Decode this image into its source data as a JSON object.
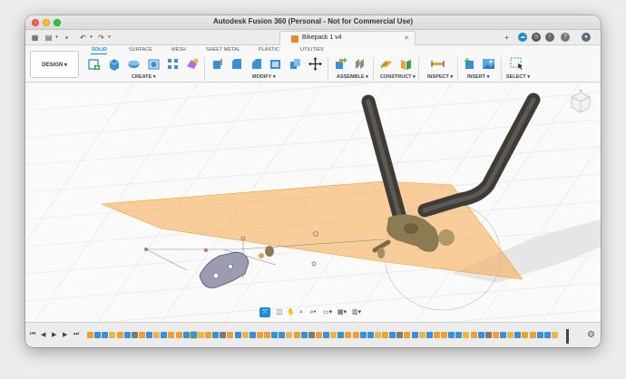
{
  "window": {
    "title": "Autodesk Fusion 360 (Personal - Not for Commercial Use)"
  },
  "tabbar": {
    "document_tab": "Bikepack 1 v4",
    "icons": [
      "grid-icon",
      "file-icon",
      "save-icon",
      "undo-icon",
      "redo-icon",
      "close-icon",
      "add-tab-icon",
      "cloud-icon",
      "clock-icon",
      "bell-icon",
      "help-icon",
      "avatar-icon"
    ]
  },
  "toolbar": {
    "workspace_button": "DESIGN ▾",
    "workspace_tabs": [
      "SOLID",
      "SURFACE",
      "MESH",
      "SHEET METAL",
      "PLASTIC",
      "UTILITIES"
    ],
    "active_tab": "SOLID",
    "groups": [
      {
        "label": "CREATE ▾"
      },
      {
        "label": "MODIFY ▾"
      },
      {
        "label": "ASSEMBLE ▾"
      },
      {
        "label": "CONSTRUCT ▾"
      },
      {
        "label": "INSPECT ▾"
      },
      {
        "label": "INSERT ▾"
      },
      {
        "label": "SELECT ▾"
      }
    ]
  },
  "viewport": {
    "nav_tools": [
      "orbit-icon",
      "look-at-icon",
      "pan-icon",
      "zoom-icon",
      "zoom-window-icon",
      "display-icon",
      "grid-icon",
      "viewports-icon"
    ]
  },
  "timeline": {
    "controls": [
      "first-icon",
      "previous-icon",
      "play-icon",
      "next-icon",
      "last-icon"
    ],
    "item_count": 64,
    "colors": {
      "sketch": "#f0a030",
      "extrude": "#3a8fd9",
      "plane": "#e8b84a",
      "joint": "#7a7a7a"
    }
  },
  "colors": {
    "accent": "#0696d7",
    "plane": "#f5a84a",
    "tube": "#4e4a44"
  }
}
